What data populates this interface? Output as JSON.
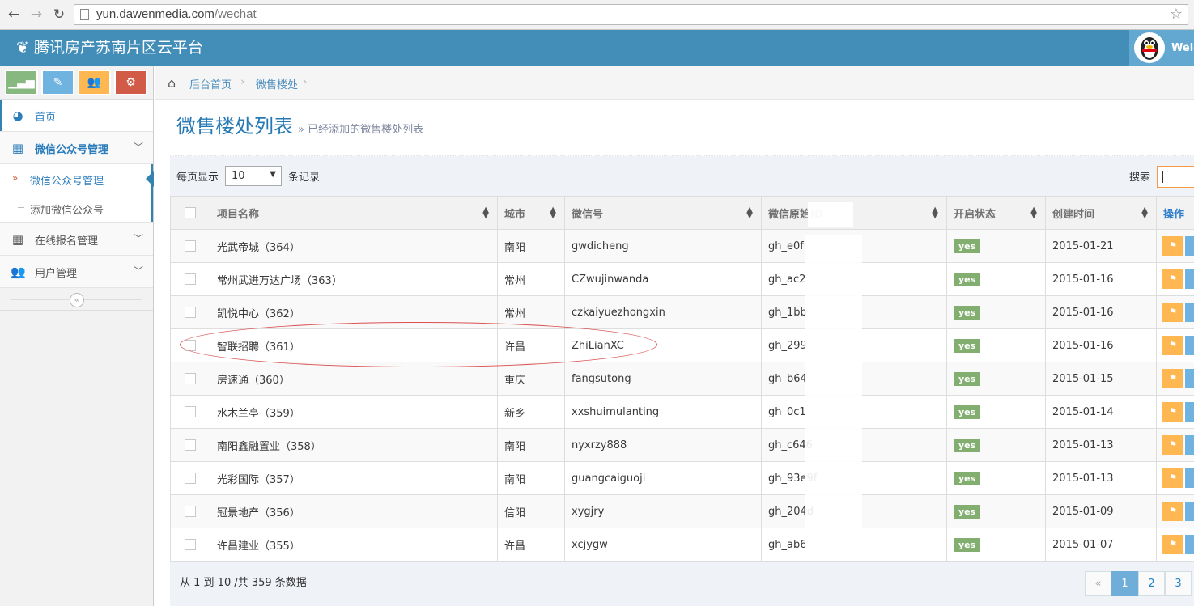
{
  "browser": {
    "back": "←",
    "forward": "→",
    "reload": "↻",
    "url_host": "yun.dawenmedia.com",
    "url_path": "/wechat",
    "star": "☆"
  },
  "navbar": {
    "brand": "腾讯房产苏南片区云平台",
    "welcome": "Welc"
  },
  "sidebar": {
    "shortcuts": [
      {
        "icon": "signal-icon",
        "color": "#87b87f"
      },
      {
        "icon": "pencil-icon",
        "color": "#6fb3e0"
      },
      {
        "icon": "group-icon",
        "color": "#ffb752"
      },
      {
        "icon": "cogs-icon",
        "color": "#d15b47"
      }
    ],
    "items": [
      {
        "label": "首页"
      },
      {
        "label": "微信公众号管理"
      },
      {
        "label": "在线报名管理"
      },
      {
        "label": "用户管理"
      }
    ],
    "subitems": [
      {
        "label": "微信公众号管理"
      },
      {
        "label": "添加微信公众号"
      }
    ],
    "collapse": "«"
  },
  "breadcrumbs": {
    "home": "后台首页",
    "current": "微售楼处",
    "sep": "›"
  },
  "page": {
    "title": "微售楼处列表",
    "subtitle": "» 已经添加的微售楼处列表"
  },
  "table_controls": {
    "per_page_prefix": "每页显示",
    "per_page_value": "10",
    "per_page_suffix": "条记录",
    "search_label": "搜索"
  },
  "table": {
    "headers": [
      "项目名称",
      "城市",
      "微信号",
      "微信原始ID",
      "开启状态",
      "创建时间",
      "操作"
    ],
    "rows": [
      {
        "name": "光武帝城（364）",
        "city": "南阳",
        "wechat": "gwdicheng",
        "raw_id": "gh_e0f",
        "status": "yes",
        "created": "2015-01-21"
      },
      {
        "name": "常州武进万达广场（363）",
        "city": "常州",
        "wechat": "CZwujinwanda",
        "raw_id": "gh_ac2",
        "status": "yes",
        "created": "2015-01-16"
      },
      {
        "name": "凯悦中心（362）",
        "city": "常州",
        "wechat": "czkaiyuezhongxin",
        "raw_id": "gh_1bb",
        "status": "yes",
        "created": "2015-01-16"
      },
      {
        "name": "智联招聘（361）",
        "city": "许昌",
        "wechat": "ZhiLianXC",
        "raw_id": "gh_299",
        "status": "yes",
        "created": "2015-01-16"
      },
      {
        "name": "房速通（360）",
        "city": "重庆",
        "wechat": "fangsutong",
        "raw_id": "gh_b64",
        "status": "yes",
        "created": "2015-01-15"
      },
      {
        "name": "水木兰亭（359）",
        "city": "新乡",
        "wechat": "xxshuimulanting",
        "raw_id": "gh_0c1",
        "status": "yes",
        "created": "2015-01-14"
      },
      {
        "name": "南阳鑫融置业（358）",
        "city": "南阳",
        "wechat": "nyxrzy888",
        "raw_id": "gh_c646",
        "status": "yes",
        "created": "2015-01-13"
      },
      {
        "name": "光彩国际（357）",
        "city": "南阳",
        "wechat": "guangcaiguoji",
        "raw_id": "gh_93e9f",
        "status": "yes",
        "created": "2015-01-13"
      },
      {
        "name": "冠景地产（356）",
        "city": "信阳",
        "wechat": "xygjry",
        "raw_id": "gh_204d",
        "status": "yes",
        "created": "2015-01-09"
      },
      {
        "name": "许昌建业（355）",
        "city": "许昌",
        "wechat": "xcjygw",
        "raw_id": "gh_ab6",
        "status": "yes",
        "created": "2015-01-07"
      }
    ]
  },
  "footer": {
    "info": "从 1 到 10 /共 359 条数据",
    "pages": [
      "«",
      "1",
      "2",
      "3"
    ]
  }
}
